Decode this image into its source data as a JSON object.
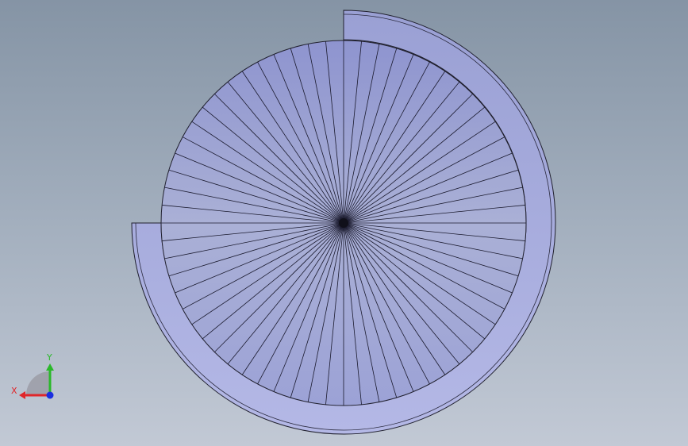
{
  "viewport": {
    "background_top": "#8594a5",
    "background_bottom": "#c2c9d5"
  },
  "model": {
    "part_fill": "#a2a8d8",
    "part_edge": "#1a1a2e",
    "stair_segments": 64,
    "stair_sweep_degrees": 270
  },
  "triad": {
    "x_label": "X",
    "y_label": "Y",
    "x_color": "#e0262a",
    "y_color": "#2ab82a",
    "z_color": "#1a2ee0"
  }
}
